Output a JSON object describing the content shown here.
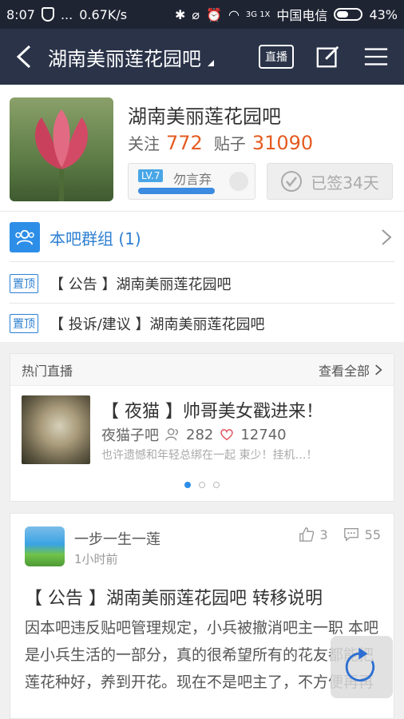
{
  "status_bar": {
    "time": "8:07",
    "dots": "...",
    "speed": "0.67K/s",
    "network": "3G 1X",
    "carrier": "中国电信",
    "battery": "43%",
    "battery_level": 0.43
  },
  "nav": {
    "title": "湖南美丽莲花园吧",
    "live_label": "直播"
  },
  "forum": {
    "name": "湖南美丽莲花园吧",
    "follow_label": "关注",
    "follow_count": "772",
    "posts_label": "贴子",
    "posts_count": "31090",
    "level_badge": "LV.7",
    "level_name": "勿言弃",
    "level_progress": 1.0,
    "sign_label": "已签34天"
  },
  "group": {
    "label": "本吧群组 (1)"
  },
  "pinned": [
    {
      "badge": "置顶",
      "text": "【 公告 】湖南美丽莲花园吧"
    },
    {
      "badge": "置顶",
      "text": "【 投诉/建议 】湖南美丽莲花园吧"
    }
  ],
  "hot_live": {
    "title": "热门直播",
    "view_all": "查看全部",
    "item": {
      "title": "【 夜猫 】帅哥美女戳进来！",
      "forum": "夜猫子吧",
      "viewers": "282",
      "likes": "12740",
      "desc": "也许遗憾和年轻总绑在一起 東少！挂机…！"
    },
    "active_page": 0,
    "page_count": 3
  },
  "post": {
    "author": "一步一生一莲",
    "time": "1小时前",
    "likes": "3",
    "comments": "55",
    "title": "【 公告 】湖南美丽莲花园吧 转移说明",
    "body": "因本吧违反贴吧管理规定，小兵被撤消吧主一职 本吧是小兵生活的一部分，真的很希望所有的花友都能把莲花种好，养到开花。现在不是吧主了，不方便再再"
  },
  "colors": {
    "nav_bg": "#2a3348",
    "accent_blue": "#2d8ee8",
    "count_orange": "#e45b20"
  }
}
